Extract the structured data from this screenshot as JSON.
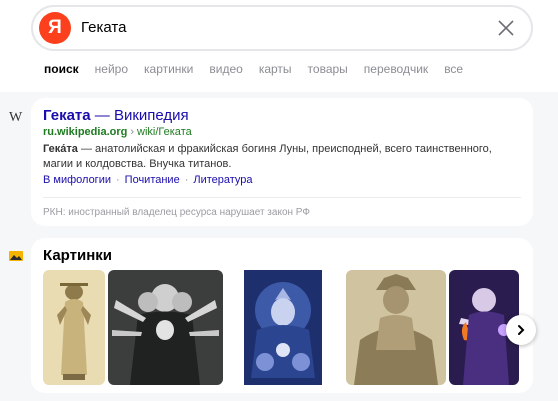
{
  "search": {
    "logo": "Я",
    "query": "Геката"
  },
  "tabs": [
    "поиск",
    "нейро",
    "картинки",
    "видео",
    "карты",
    "товары",
    "переводчик",
    "все"
  ],
  "result": {
    "title_bold": "Геката",
    "title_rest": " — Википедия",
    "domain": "ru.wikipedia.org",
    "path_sep": "›",
    "path": "wiki/Геката",
    "snippet_bold": "Гека́та",
    "snippet_rest": " — анатолийская и фракийская богиня Луны, преисподней, всего таинственного, магии и колдовства. Внучка титанов.",
    "sitelinks": [
      "В мифологии",
      "Почитание",
      "Литература"
    ],
    "sitelink_sep": "·",
    "rkn": "РКН: иностранный владелец ресурса нарушает закон РФ"
  },
  "images": {
    "heading": "Картинки"
  },
  "side_icons": [
    "wikipedia-w-icon",
    "image-icon"
  ],
  "colors": {
    "brand": "#fc3f1d",
    "link": "#1a0dab",
    "url_green": "#1e7b20",
    "page_bg": "#f6f7f9"
  }
}
